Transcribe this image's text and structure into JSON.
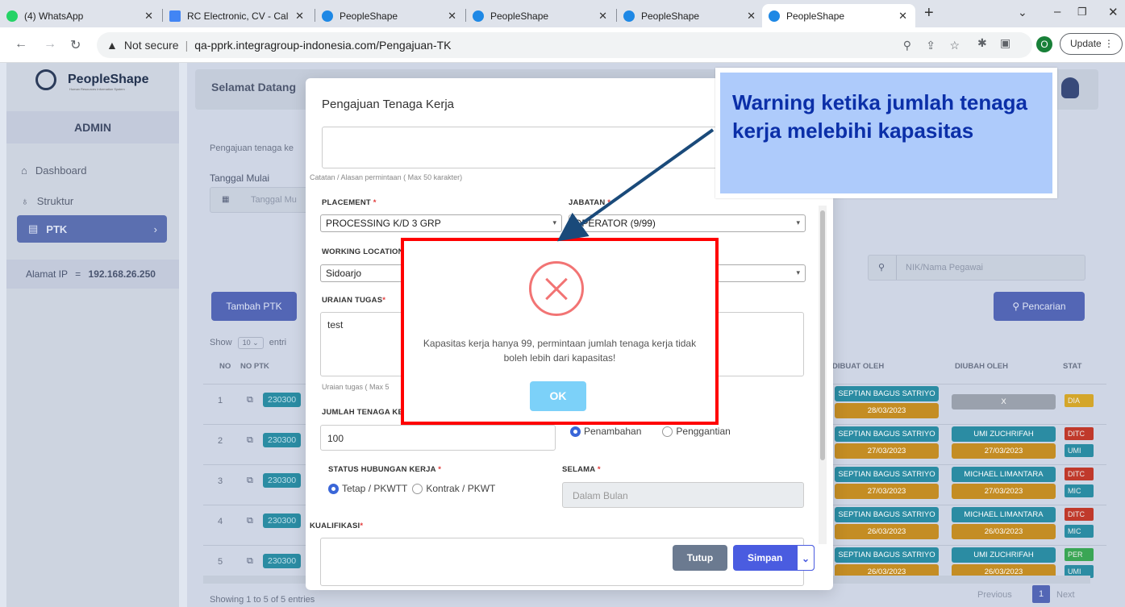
{
  "browser": {
    "tabs": [
      {
        "label": "(4) WhatsApp",
        "icon": "whatsapp-icon",
        "color": "#25d366"
      },
      {
        "label": "RC Electronic, CV - Cal",
        "icon": "calendar-icon",
        "color": "#4285f4"
      },
      {
        "label": "PeopleShape",
        "icon": "peopleshape-icon",
        "color": "#1e88e5"
      },
      {
        "label": "PeopleShape",
        "icon": "peopleshape-icon",
        "color": "#1e88e5"
      },
      {
        "label": "PeopleShape",
        "icon": "peopleshape-icon",
        "color": "#1e88e5"
      },
      {
        "label": "PeopleShape",
        "icon": "peopleshape-icon",
        "color": "#1e88e5"
      }
    ],
    "security_label": "Not secure",
    "url": "qa-pprk.integragroup-indonesia.com/Pengajuan-TK",
    "profile_initial": "O",
    "update_label": "Update"
  },
  "sidebar": {
    "brand": "PeopleShape",
    "brand_sub": "Human Resources Information System",
    "role": "ADMIN",
    "items": [
      {
        "label": "Dashboard",
        "icon": "home-icon"
      },
      {
        "label": "Struktur",
        "icon": "org-chart-icon"
      },
      {
        "label": "PTK",
        "icon": "calendar-icon",
        "active": true
      }
    ],
    "ip_label": "Alamat IP",
    "ip_sep": "=",
    "ip_value": "192.168.26.250"
  },
  "header": {
    "welcome": "Selamat Datang"
  },
  "page": {
    "breadcrumb": "Pengajuan tenaga ke",
    "start_date_label": "Tanggal Mulai",
    "start_date_placeholder": "Tanggal Mu",
    "search_placeholder": "NIK/Nama Pegawai",
    "add_button": "Tambah PTK",
    "search_button": "Pencarian",
    "show_label": "Show",
    "entries_count": "10",
    "entries_label": "entri",
    "footer_info": "Showing 1 to 5 of 5 entries",
    "prev_label": "Previous",
    "page_number": "1",
    "next_label": "Next"
  },
  "table": {
    "headers": [
      "NO",
      "NO PTK",
      "DIBUAT OLEH",
      "DIUBAH OLEH",
      "STAT"
    ],
    "rows": [
      {
        "no": "1",
        "ptk": "230300",
        "created_by": "SEPTIAN BAGUS SATRIYO",
        "created_at": "28/03/2023",
        "updated_by": "X",
        "updated_at": "",
        "status": "DIA",
        "status_color": "#d4a62a"
      },
      {
        "no": "2",
        "ptk": "230300",
        "created_by": "SEPTIAN BAGUS SATRIYO",
        "created_at": "27/03/2023",
        "updated_by": "UMI ZUCHRIFAH",
        "updated_at": "27/03/2023",
        "status": "DITC",
        "status_color": "#c0392b",
        "status2": "UMI"
      },
      {
        "no": "3",
        "ptk": "230300",
        "created_by": "SEPTIAN BAGUS SATRIYO",
        "created_at": "27/03/2023",
        "updated_by": "MICHAEL LIMANTARA",
        "updated_at": "27/03/2023",
        "status": "DITC",
        "status_color": "#c0392b",
        "status2": "MIC"
      },
      {
        "no": "4",
        "ptk": "230300",
        "created_by": "SEPTIAN BAGUS SATRIYO",
        "created_at": "26/03/2023",
        "updated_by": "MICHAEL LIMANTARA",
        "updated_at": "26/03/2023",
        "status": "DITC",
        "status_color": "#c0392b",
        "status2": "MIC"
      },
      {
        "no": "5",
        "ptk": "230300",
        "created_by": "SEPTIAN BAGUS SATRIYO",
        "created_at": "26/03/2023",
        "updated_by": "UMI ZUCHRIFAH",
        "updated_at": "26/03/2023",
        "status": "PER",
        "status_color": "#3aa655",
        "status2": "UMI"
      }
    ]
  },
  "modal": {
    "title": "Pengajuan Tenaga Kerja",
    "notes_hint": "Catatan / Alasan permintaan ( Max 50 karakter)",
    "placement_label": "PLACEMENT",
    "placement_value": "PROCESSING K/D 3 GRP",
    "jabatan_label": "JABATAN",
    "jabatan_value": "OPERATOR (9/99)",
    "working_location_label": "WORKING LOCATION",
    "working_location_value": "Sidoarjo",
    "uraian_label": "URAIAN TUGAS",
    "uraian_value": "test",
    "uraian_hint": "Uraian tugas ( Max 5",
    "jumlah_label": "JUMLAH TENAGA KE",
    "jumlah_value": "100",
    "penambahan_label": "Penambahan",
    "penggantian_label": "Penggantian",
    "status_label": "STATUS HUBUNGAN KERJA",
    "tetap_label": "Tetap / PKWTT",
    "kontrak_label": "Kontrak / PKWT",
    "selama_label": "SELAMA",
    "selama_placeholder": "Dalam Bulan",
    "kualifikasi_label": "KUALIFIKASI",
    "close_button": "Tutup",
    "save_button": "Simpan"
  },
  "alert": {
    "message": "Kapasitas kerja hanya 99, permintaan jumlah tenaga kerja tidak boleh lebih dari kapasitas!",
    "ok_button": "OK",
    "icon": "error-x-icon",
    "icon_color": "#f27474",
    "ok_color": "#7cd1f9"
  },
  "annotation": {
    "text": "Warning ketika jumlah tenaga kerja melebihi kapasitas",
    "text_color": "#0b2fa8",
    "bg_color": "#aecbfb"
  }
}
